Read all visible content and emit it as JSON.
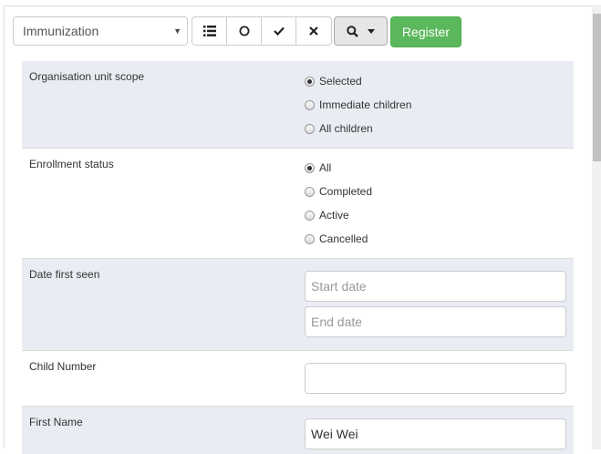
{
  "toolbar": {
    "program_select": "Immunization",
    "list_icon": "list-icon",
    "circle_icon": "circle-icon",
    "check_icon": "check-icon",
    "cross_icon": "times-icon",
    "search_icon": "search-icon",
    "register_label": "Register"
  },
  "filters": {
    "org_unit_scope": {
      "label": "Organisation unit scope",
      "options": [
        "Selected",
        "Immediate children",
        "All children"
      ],
      "selected": "Selected"
    },
    "enrollment_status": {
      "label": "Enrollment status",
      "options": [
        "All",
        "Completed",
        "Active",
        "Cancelled"
      ],
      "selected": "All"
    },
    "date_first_seen": {
      "label": "Date first seen",
      "start_placeholder": "Start date",
      "end_placeholder": "End date"
    },
    "child_number": {
      "label": "Child Number",
      "value": ""
    },
    "first_name": {
      "label": "First Name",
      "value": "Wei Wei"
    }
  },
  "colors": {
    "register": "#5cb85c",
    "row_shade": "#e9edf3"
  }
}
